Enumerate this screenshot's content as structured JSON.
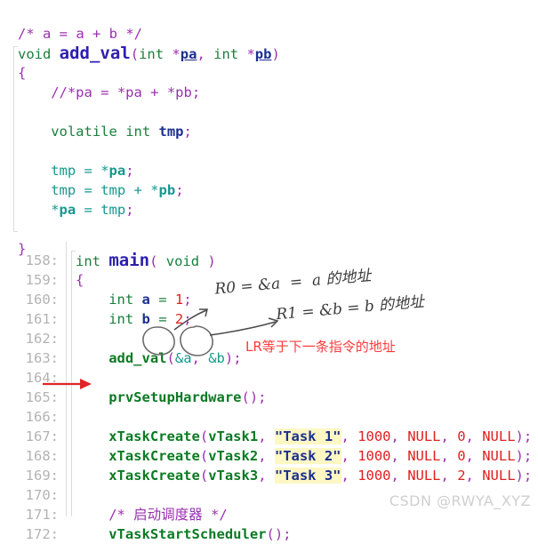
{
  "editor": {
    "background": "#ffffff",
    "gutter_color": "#b3b3b3",
    "comment_color": "#9b30b0",
    "keyword_color": "#1a7f3c",
    "function_name_color": "#2d1fae",
    "function_call_color": "#0c7a23",
    "variable_color": "#1c2f8f",
    "number_color": "#e02020",
    "string_highlight_bg": "#fdf7c3",
    "annotation_red": "#ff3b3b",
    "teal_color": "#17998e"
  },
  "upper_block": {
    "lines": [
      {
        "indent": 0,
        "tokens": [
          {
            "t": "/* a = a + b */",
            "c": "c-comment"
          }
        ]
      },
      {
        "indent": 0,
        "tokens": [
          {
            "t": "void ",
            "c": "c-keyword"
          },
          {
            "t": "add_val",
            "c": "c-fnname"
          },
          {
            "t": "(",
            "c": "c-punct"
          },
          {
            "t": "int ",
            "c": "c-keyword"
          },
          {
            "t": "*",
            "c": "c-punct"
          },
          {
            "t": "pa",
            "c": "c-varu"
          },
          {
            "t": ", ",
            "c": "c-punct"
          },
          {
            "t": "int ",
            "c": "c-keyword"
          },
          {
            "t": "*",
            "c": "c-punct"
          },
          {
            "t": "pb",
            "c": "c-varu"
          },
          {
            "t": ")",
            "c": "c-punct"
          }
        ]
      },
      {
        "indent": 0,
        "tokens": [
          {
            "t": "{",
            "c": "c-punct"
          }
        ]
      },
      {
        "indent": 1,
        "tokens": [
          {
            "t": "//*pa = *pa + *pb;",
            "c": "c-comment"
          }
        ]
      },
      {
        "indent": 0,
        "tokens": []
      },
      {
        "indent": 1,
        "tokens": [
          {
            "t": "volatile ",
            "c": "c-keyword"
          },
          {
            "t": "int ",
            "c": "c-keyword"
          },
          {
            "t": "tmp",
            "c": "c-var"
          },
          {
            "t": ";",
            "c": "c-punct"
          }
        ]
      },
      {
        "indent": 0,
        "tokens": []
      },
      {
        "indent": 1,
        "tokens": [
          {
            "t": "tmp ",
            "c": "c-teal"
          },
          {
            "t": "= ",
            "c": "c-teal"
          },
          {
            "t": "*",
            "c": "c-teal"
          },
          {
            "t": "pa",
            "c": "c-tealb"
          },
          {
            "t": ";",
            "c": "c-punct"
          }
        ]
      },
      {
        "indent": 1,
        "tokens": [
          {
            "t": "tmp ",
            "c": "c-teal"
          },
          {
            "t": "= ",
            "c": "c-teal"
          },
          {
            "t": "tmp ",
            "c": "c-teal"
          },
          {
            "t": "+ ",
            "c": "c-teal"
          },
          {
            "t": "*",
            "c": "c-teal"
          },
          {
            "t": "pb",
            "c": "c-tealb"
          },
          {
            "t": ";",
            "c": "c-punct"
          }
        ]
      },
      {
        "indent": 1,
        "tokens": [
          {
            "t": "*",
            "c": "c-teal"
          },
          {
            "t": "pa",
            "c": "c-tealb"
          },
          {
            "t": " = ",
            "c": "c-teal"
          },
          {
            "t": "tmp",
            "c": "c-teal"
          },
          {
            "t": ";",
            "c": "c-punct"
          }
        ]
      },
      {
        "indent": 0,
        "tokens": []
      },
      {
        "indent": 0,
        "tokens": [
          {
            "t": "}",
            "c": "c-punct"
          }
        ]
      }
    ]
  },
  "lower_block": {
    "line_numbers": [
      "158:",
      "159:",
      "160:",
      "161:",
      "162:",
      "163:",
      "164:",
      "165:",
      "166:",
      "167:",
      "168:",
      "169:",
      "170:",
      "171:",
      "172:"
    ],
    "lines": [
      {
        "indent": 0,
        "tokens": [
          {
            "t": "int ",
            "c": "c-keyword"
          },
          {
            "t": "main",
            "c": "c-fnname"
          },
          {
            "t": "( ",
            "c": "c-punct"
          },
          {
            "t": "void",
            "c": "c-keyword"
          },
          {
            "t": " )",
            "c": "c-punct"
          }
        ]
      },
      {
        "indent": 0,
        "tokens": [
          {
            "t": "{",
            "c": "c-punct"
          }
        ]
      },
      {
        "indent": 1,
        "tokens": [
          {
            "t": "int ",
            "c": "c-keyword"
          },
          {
            "t": "a",
            "c": "c-var"
          },
          {
            "t": " = ",
            "c": "c-plain"
          },
          {
            "t": "1",
            "c": "c-num"
          },
          {
            "t": ";",
            "c": "c-punct"
          }
        ]
      },
      {
        "indent": 1,
        "tokens": [
          {
            "t": "int ",
            "c": "c-keyword"
          },
          {
            "t": "b",
            "c": "c-var"
          },
          {
            "t": " = ",
            "c": "c-plain"
          },
          {
            "t": "2",
            "c": "c-num"
          },
          {
            "t": ";",
            "c": "c-punct"
          }
        ]
      },
      {
        "indent": 0,
        "tokens": []
      },
      {
        "indent": 1,
        "tokens": [
          {
            "t": "add_val",
            "c": "c-fncall"
          },
          {
            "t": "(",
            "c": "c-punct"
          },
          {
            "t": "&a",
            "c": "c-teal"
          },
          {
            "t": ", ",
            "c": "c-punct"
          },
          {
            "t": "&b",
            "c": "c-teal"
          },
          {
            "t": ")",
            "c": "c-punct"
          },
          {
            "t": ";",
            "c": "c-punct"
          }
        ]
      },
      {
        "indent": 0,
        "tokens": []
      },
      {
        "indent": 1,
        "tokens": [
          {
            "t": "prvSetupHardware",
            "c": "c-fncall"
          },
          {
            "t": "();",
            "c": "c-punct"
          }
        ]
      },
      {
        "indent": 0,
        "tokens": []
      },
      {
        "indent": 1,
        "tokens": [
          {
            "t": "xTaskCreate",
            "c": "c-fncall"
          },
          {
            "t": "(",
            "c": "c-punct"
          },
          {
            "t": "vTask1",
            "c": "c-fncall"
          },
          {
            "t": ", ",
            "c": "c-punct"
          },
          {
            "t": "\"Task 1\"",
            "c": "c-str"
          },
          {
            "t": ", ",
            "c": "c-punct"
          },
          {
            "t": "1000",
            "c": "c-num"
          },
          {
            "t": ", ",
            "c": "c-punct"
          },
          {
            "t": "NULL",
            "c": "c-num"
          },
          {
            "t": ", ",
            "c": "c-punct"
          },
          {
            "t": "0",
            "c": "c-num"
          },
          {
            "t": ", ",
            "c": "c-punct"
          },
          {
            "t": "NULL",
            "c": "c-num"
          },
          {
            "t": ");",
            "c": "c-punct"
          }
        ]
      },
      {
        "indent": 1,
        "tokens": [
          {
            "t": "xTaskCreate",
            "c": "c-fncall"
          },
          {
            "t": "(",
            "c": "c-punct"
          },
          {
            "t": "vTask2",
            "c": "c-fncall"
          },
          {
            "t": ", ",
            "c": "c-punct"
          },
          {
            "t": "\"Task 2\"",
            "c": "c-str"
          },
          {
            "t": ", ",
            "c": "c-punct"
          },
          {
            "t": "1000",
            "c": "c-num"
          },
          {
            "t": ", ",
            "c": "c-punct"
          },
          {
            "t": "NULL",
            "c": "c-num"
          },
          {
            "t": ", ",
            "c": "c-punct"
          },
          {
            "t": "0",
            "c": "c-num"
          },
          {
            "t": ", ",
            "c": "c-punct"
          },
          {
            "t": "NULL",
            "c": "c-num"
          },
          {
            "t": ");",
            "c": "c-punct"
          }
        ]
      },
      {
        "indent": 1,
        "tokens": [
          {
            "t": "xTaskCreate",
            "c": "c-fncall"
          },
          {
            "t": "(",
            "c": "c-punct"
          },
          {
            "t": "vTask3",
            "c": "c-fncall"
          },
          {
            "t": ", ",
            "c": "c-punct"
          },
          {
            "t": "\"Task 3\"",
            "c": "c-str"
          },
          {
            "t": ", ",
            "c": "c-punct"
          },
          {
            "t": "1000",
            "c": "c-num"
          },
          {
            "t": ", ",
            "c": "c-punct"
          },
          {
            "t": "NULL",
            "c": "c-num"
          },
          {
            "t": ", ",
            "c": "c-punct"
          },
          {
            "t": "2",
            "c": "c-num"
          },
          {
            "t": ", ",
            "c": "c-punct"
          },
          {
            "t": "NULL",
            "c": "c-num"
          },
          {
            "t": ");",
            "c": "c-punct"
          }
        ]
      },
      {
        "indent": 0,
        "tokens": []
      },
      {
        "indent": 1,
        "tokens": [
          {
            "t": "/* 启动调度器 */",
            "c": "c-comment"
          }
        ]
      },
      {
        "indent": 1,
        "tokens": [
          {
            "t": "vTaskStartScheduler",
            "c": "c-fncall"
          },
          {
            "t": "();",
            "c": "c-punct"
          }
        ]
      }
    ]
  },
  "annotations": {
    "handwritten": [
      {
        "text": "R0 = &a  =  a 的地址",
        "name": "handwritten-note-r0"
      },
      {
        "text": "R1 = &b = b 的地址",
        "name": "handwritten-note-r1"
      }
    ],
    "red_note": "LR等于下一条指令的地址"
  },
  "watermark": "CSDN @RWYA_XYZ"
}
